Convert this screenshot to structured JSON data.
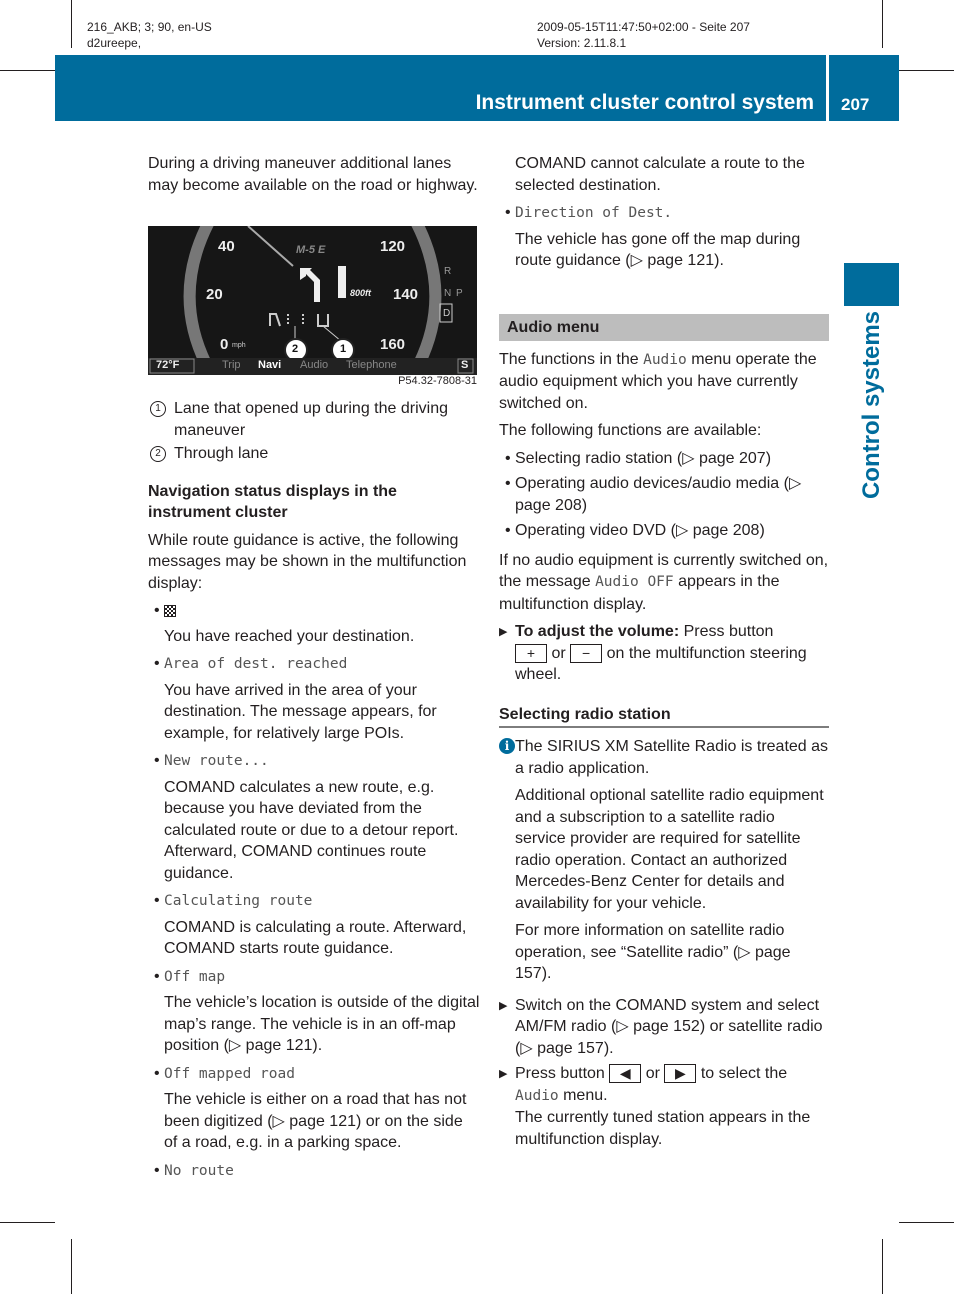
{
  "meta": {
    "top_left_line1": "216_AKB; 3; 90, en-US",
    "top_left_line2": "d2ureepe,",
    "top_right_line1": "2009-05-15T11:47:50+02:00 - Seite 207",
    "top_right_line2": "Version: 2.11.8.1"
  },
  "header": {
    "title": "Instrument cluster control system",
    "page_number": "207",
    "side_tab_label": "Control systems",
    "brand_color": "#006c9c"
  },
  "left": {
    "intro": "During a driving maneuver additional lanes may become available on the road or highway.",
    "figure": {
      "speed_labels": [
        "40",
        "20",
        "0",
        "120",
        "140",
        "160"
      ],
      "speed_unit": "mph",
      "road_name": "M-5 E",
      "distance": "800ft",
      "gear_labels": [
        "R",
        "N",
        "P",
        "D"
      ],
      "temperature": "72°F",
      "menu_items": [
        "Trip",
        "Navi",
        "Audio",
        "Telephone"
      ],
      "active_menu": "Navi",
      "s_indicator": "S",
      "callouts": [
        "2",
        "1"
      ],
      "caption": "P54.32-7808-31"
    },
    "legend": [
      {
        "num": "1",
        "text": "Lane that opened up during the driving maneuver"
      },
      {
        "num": "2",
        "text": "Through lane"
      }
    ],
    "nav_heading": "Navigation status displays in the instrument cluster",
    "nav_intro": "While route guidance is active, the following messages may be shown in the multifunction display:",
    "messages": [
      {
        "code": "",
        "icon": "checkered-flag-icon",
        "desc": "You have reached your destination."
      },
      {
        "code": "Area of dest. reached",
        "desc": "You have arrived in the area of your destination. The message appears, for example, for relatively large POIs."
      },
      {
        "code": "New route...",
        "desc": "COMAND calculates a new route, e.g. because you have deviated from the calculated route or due to a detour report. Afterward, COMAND continues route guidance."
      },
      {
        "code": "Calculating route",
        "desc": "COMAND is calculating a route. Afterward, COMAND starts route guidance."
      },
      {
        "code": "Off map",
        "desc": "The vehicle’s location is outside of the digital map’s range. The vehicle is in an off-map position (▷ page 121)."
      },
      {
        "code": "Off mapped road",
        "desc": "The vehicle is either on a road that has not been digitized (▷ page 121) or on the side of a road, e.g. in a parking space."
      },
      {
        "code": "No route",
        "desc": ""
      }
    ]
  },
  "right": {
    "no_route_desc": "COMAND cannot calculate a route to the selected destination.",
    "direction_code": "Direction of Dest.",
    "direction_desc": "The vehicle has gone off the map during route guidance (▷ page 121).",
    "audio_heading": "Audio menu",
    "audio_p1_pre": "The functions in the ",
    "audio_p1_code": "Audio",
    "audio_p1_post": " menu operate the audio equipment which you have currently switched on.",
    "audio_p2": "The following functions are available:",
    "functions": [
      "Selecting radio station (▷ page 207)",
      "Operating audio devices/audio media (▷ page 208)",
      "Operating video DVD (▷ page 208)"
    ],
    "audio_off_pre": "If no audio equipment is currently switched on, the message ",
    "audio_off_code": "Audio OFF",
    "audio_off_post": " appears in the multifunction display.",
    "volume_bold": "To adjust the volume:",
    "volume_pre": " Press button ",
    "key_plus": "+",
    "or_word": " or ",
    "key_minus": "−",
    "volume_post": " on the multifunction steering wheel.",
    "radio_heading": "Selecting radio station",
    "info_p1": "The SIRIUS XM Satellite Radio is treated as a radio application.",
    "info_p2": "Additional optional satellite radio equipment and a subscription to a satellite radio service provider are required for satellite radio operation. Contact an authorized Mercedes-Benz Center for details and availability for your vehicle.",
    "info_p3": "For more information on satellite radio operation, see “Satellite radio” (▷ page 157).",
    "step1": "Switch on the COMAND system and select AM/FM radio (▷ page 152) or satellite radio (▷ page 157).",
    "step2_pre": "Press button ",
    "key_left": "◀",
    "key_right": "▶",
    "step2_post": " to select the",
    "step2_code": "Audio",
    "step2_menu": " menu.",
    "step2_result": "The currently tuned station appears in the multifunction display."
  }
}
